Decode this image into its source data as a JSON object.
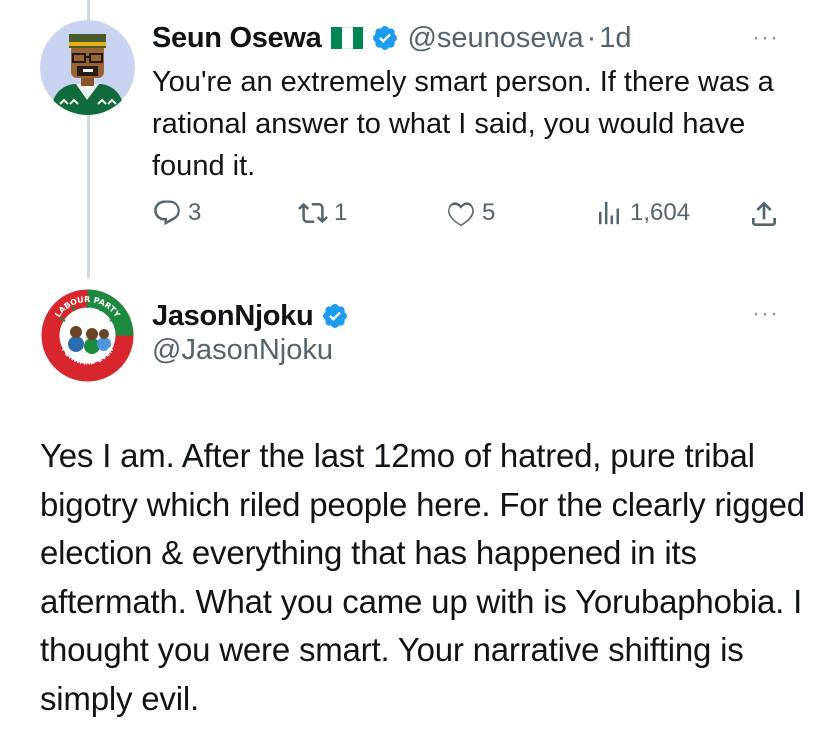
{
  "tweet1": {
    "name": "Seun Osewa",
    "handle": "@seunosewa",
    "separator": "·",
    "time": "1d",
    "text": "You're an extremely smart person. If there was a rational answer to what I said, you would have found it.",
    "actions": {
      "replies": "3",
      "retweets": "1",
      "likes": "5",
      "views": "1,604"
    },
    "more_label": "···",
    "flag_colors": [
      "#008751",
      "#ffffff",
      "#008751"
    ]
  },
  "tweet2": {
    "name": "JasonNjoku",
    "handle": "@JasonNjoku",
    "more_label": "···",
    "text": "Yes I am. After the last 12mo of hatred, pure tribal bigotry which riled people here. For the clearly rigged election & everything that has happened in its aftermath. What you came up with is Yorubaphobia. I thought you were smart. Your narrative shifting is simply evil.",
    "avatar_logo_top": "LABOUR PARTY",
    "avatar_logo_bottom": "FORWARD EVER"
  },
  "colors": {
    "verified": "#1d9bf0",
    "secondary_text": "#536471",
    "thread_line": "#cfd9de",
    "labour_red": "#d7262c",
    "labour_green": "#1c8a3e"
  },
  "icons": [
    "reply-icon",
    "retweet-icon",
    "like-icon",
    "views-icon",
    "share-icon",
    "verified-icon",
    "nigeria-flag-icon",
    "more-icon"
  ]
}
